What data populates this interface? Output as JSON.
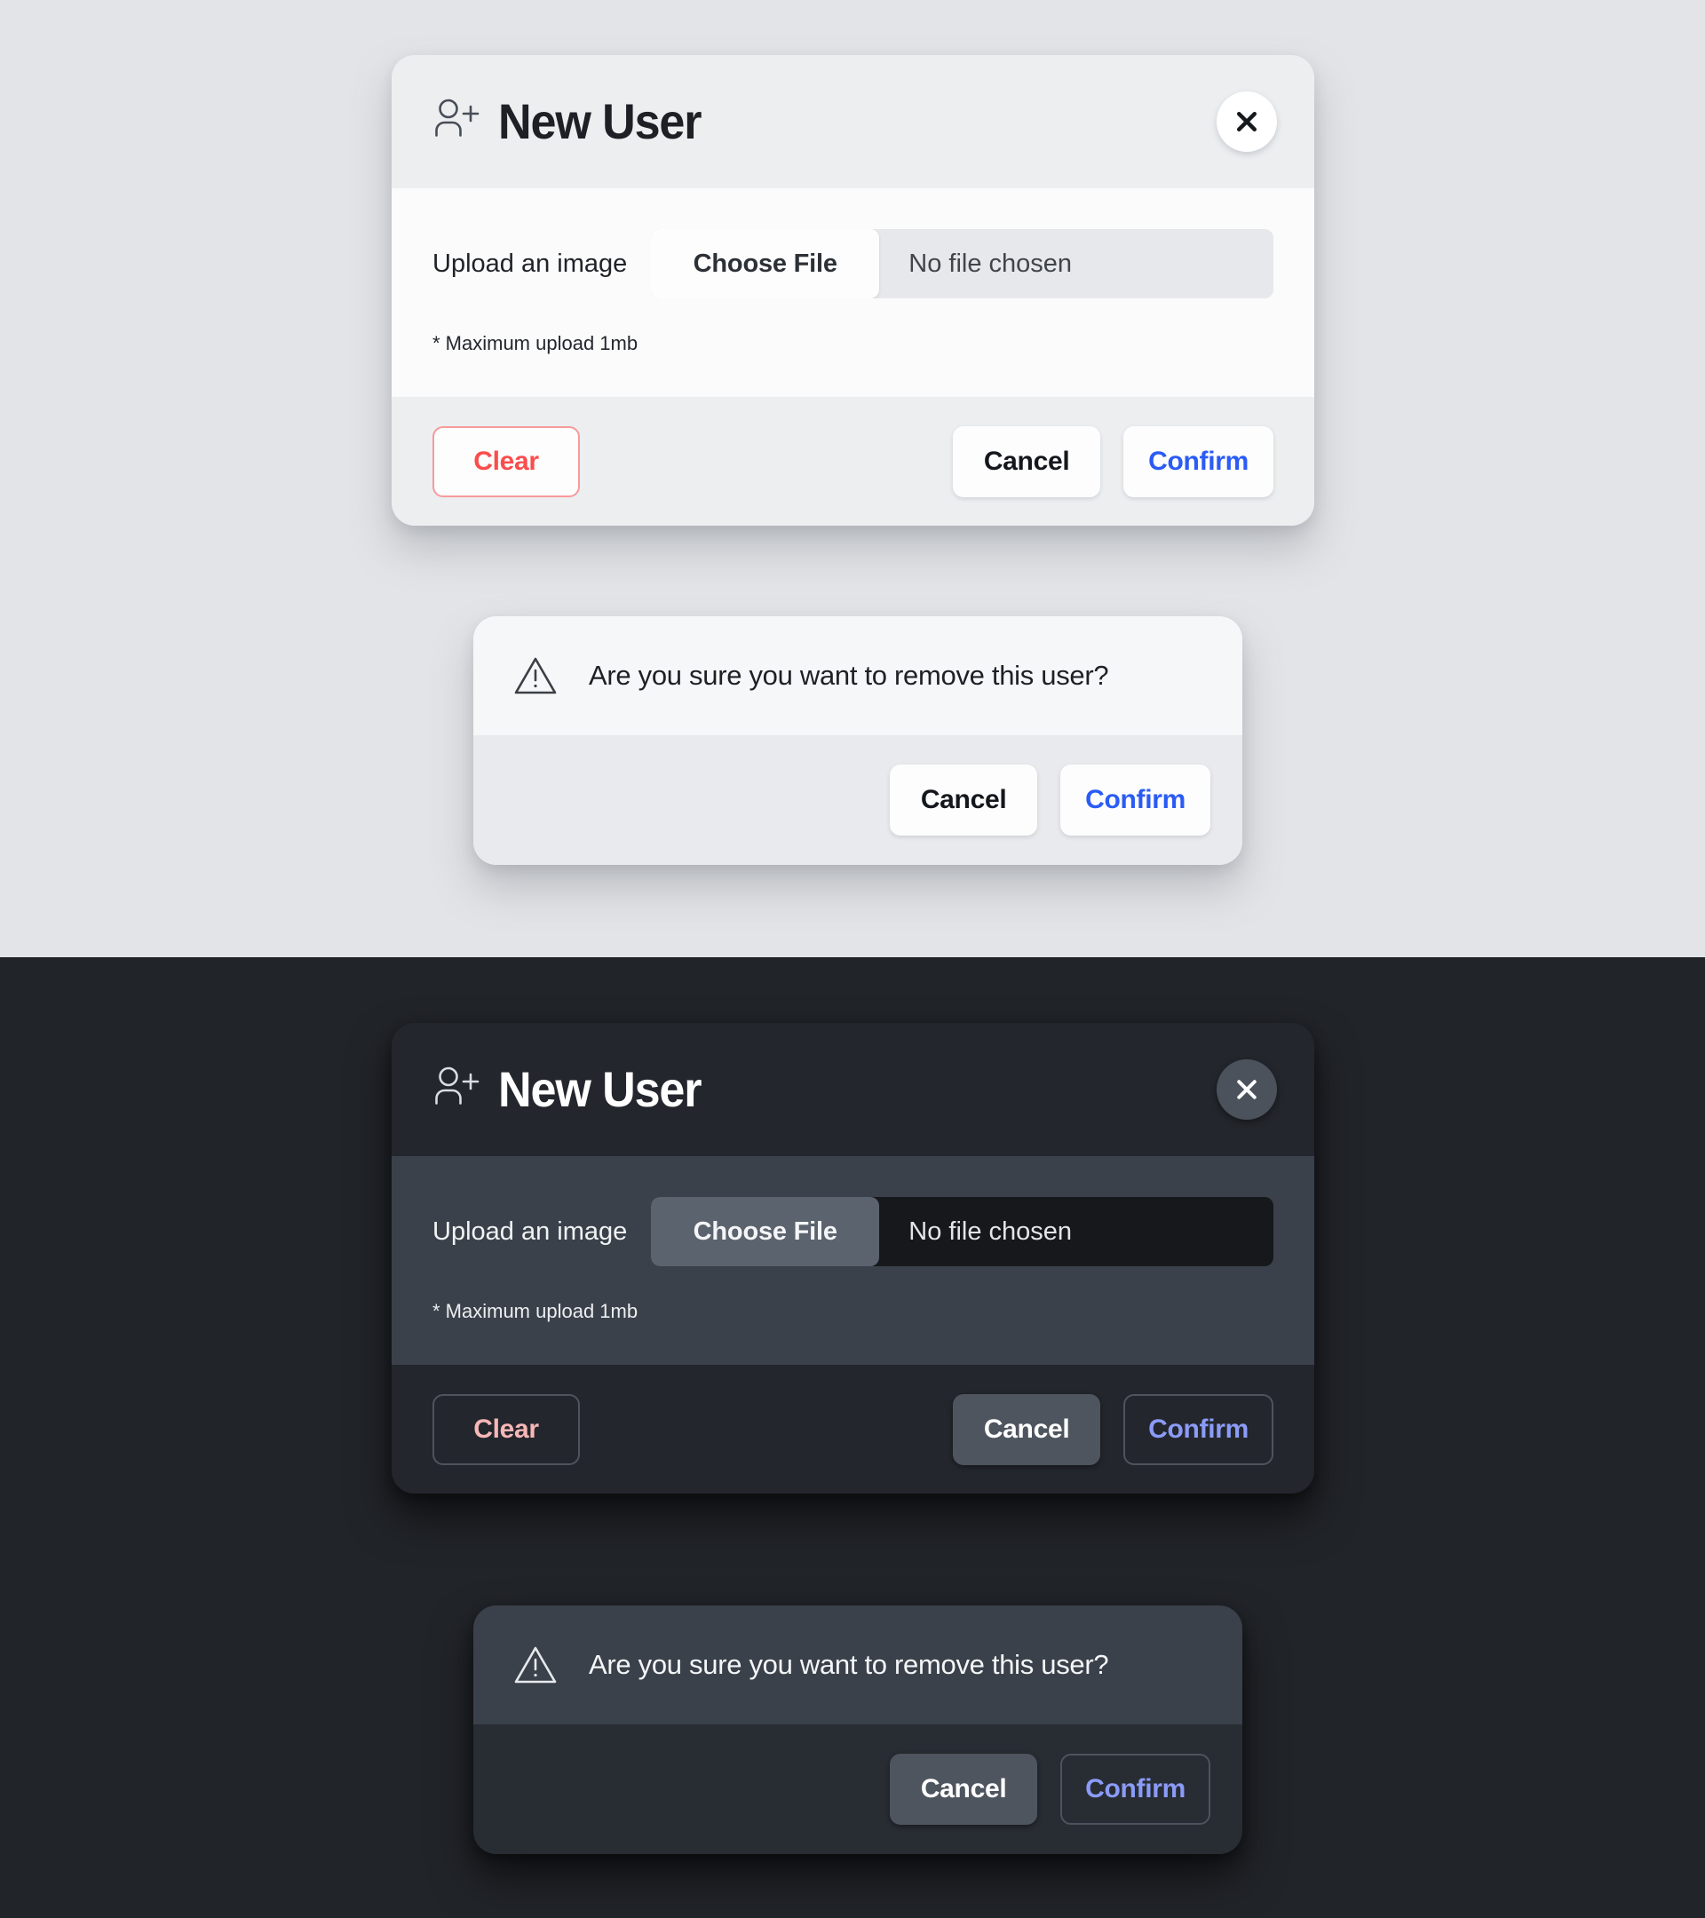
{
  "themes": {
    "light": {
      "name": "light",
      "background_color": "#e2e4e7"
    },
    "dark": {
      "name": "dark",
      "background_color": "#212429"
    }
  },
  "new_user_dialog": {
    "title": "New User",
    "title_icon": "person-add-icon",
    "close_icon": "close-icon",
    "upload": {
      "label": "Upload an image",
      "choose_file_label": "Choose File",
      "file_name": "No file chosen",
      "hint": "* Maximum upload 1mb"
    },
    "footer": {
      "clear_label": "Clear",
      "cancel_label": "Cancel",
      "confirm_label": "Confirm"
    }
  },
  "confirm_dialog": {
    "warning_icon": "warning-triangle-icon",
    "message": "Are you sure you want to remove this user?",
    "footer": {
      "cancel_label": "Cancel",
      "confirm_label": "Confirm"
    }
  },
  "colors": {
    "danger": "#fb4d4d",
    "danger_dark": "#f6b7b7",
    "accent": "#2b5bf5",
    "accent_dark": "#8b9bf8"
  }
}
